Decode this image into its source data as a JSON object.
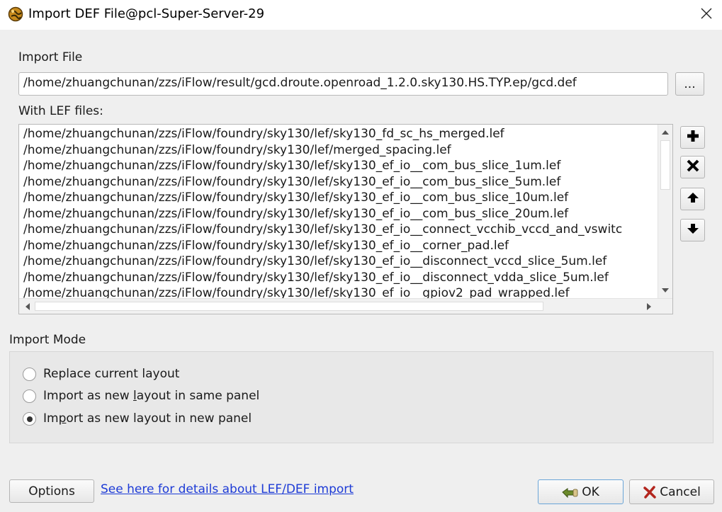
{
  "window": {
    "title": "Import DEF File@pcl-Super-Server-29",
    "icon": "app-globe-icon",
    "close_icon": "close-icon"
  },
  "import_file": {
    "label": "Import File",
    "path": "/home/zhuangchunan/zzs/iFlow/result/gcd.droute.openroad_1.2.0.sky130.HS.TYP.ep/gcd.def",
    "browse_label": "..."
  },
  "lef_files": {
    "label": "With LEF files:",
    "items": [
      "/home/zhuangchunan/zzs/iFlow/foundry/sky130/lef/sky130_fd_sc_hs_merged.lef",
      "/home/zhuangchunan/zzs/iFlow/foundry/sky130/lef/merged_spacing.lef",
      "/home/zhuangchunan/zzs/iFlow/foundry/sky130/lef/sky130_ef_io__com_bus_slice_1um.lef",
      "/home/zhuangchunan/zzs/iFlow/foundry/sky130/lef/sky130_ef_io__com_bus_slice_5um.lef",
      "/home/zhuangchunan/zzs/iFlow/foundry/sky130/lef/sky130_ef_io__com_bus_slice_10um.lef",
      "/home/zhuangchunan/zzs/iFlow/foundry/sky130/lef/sky130_ef_io__com_bus_slice_20um.lef",
      "/home/zhuangchunan/zzs/iFlow/foundry/sky130/lef/sky130_ef_io__connect_vcchib_vccd_and_vswitc",
      "/home/zhuangchunan/zzs/iFlow/foundry/sky130/lef/sky130_ef_io__corner_pad.lef",
      "/home/zhuangchunan/zzs/iFlow/foundry/sky130/lef/sky130_ef_io__disconnect_vccd_slice_5um.lef",
      "/home/zhuangchunan/zzs/iFlow/foundry/sky130/lef/sky130_ef_io__disconnect_vdda_slice_5um.lef",
      "/home/zhuangchunan/zzs/iFlow/foundry/sky130/lef/sky130_ef_io__gpiov2_pad_wrapped.lef"
    ],
    "buttons": [
      "add-icon",
      "remove-icon",
      "move-up-icon",
      "move-down-icon"
    ]
  },
  "import_mode": {
    "label": "Import Mode",
    "options": [
      {
        "pre": "Replace current layout",
        "u": "",
        "post": "",
        "checked": false
      },
      {
        "pre": "Import as new ",
        "u": "l",
        "post": "ayout in same panel",
        "checked": false
      },
      {
        "pre": "Im",
        "u": "p",
        "post": "ort as new layout in new panel",
        "checked": true
      }
    ]
  },
  "footer": {
    "options_label": "Options",
    "link_text": "See here for details about LEF/DEF import",
    "ok_label": "OK",
    "cancel_label": "Cancel",
    "ok_icon": "ok-hand-icon",
    "cancel_icon": "cancel-x-icon"
  }
}
